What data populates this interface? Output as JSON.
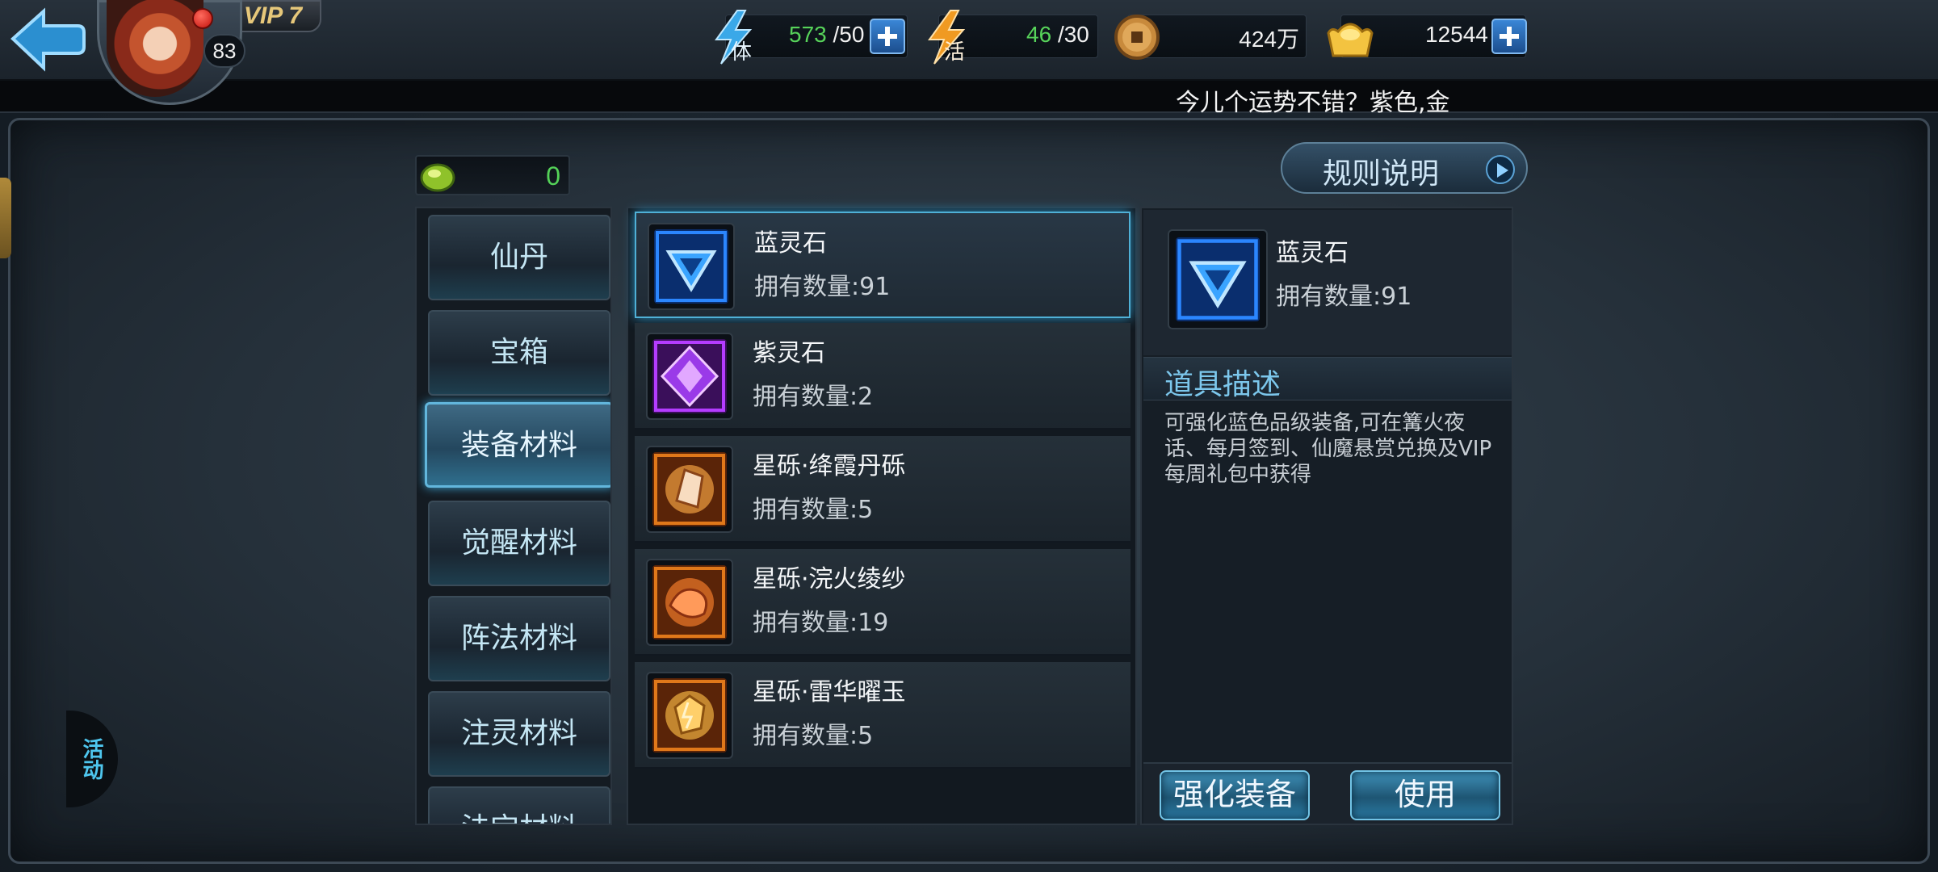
{
  "header": {
    "vip_label": "VIP 7",
    "player_level": "83",
    "stamina": {
      "icon": "stamina-lightning-icon",
      "current": "573",
      "max": "/50"
    },
    "activity": {
      "icon": "activity-lightning-icon",
      "current": "46",
      "max": "/30"
    },
    "copper": {
      "icon": "copper-coin-icon",
      "value": "424万"
    },
    "gold": {
      "icon": "gold-ingot-icon",
      "value": "12544"
    }
  },
  "marquee": {
    "text": "今儿个运势不错？紫色,金"
  },
  "currency": {
    "icon": "green-gem-icon",
    "value": "0"
  },
  "rules_button": {
    "label": "规则说明"
  },
  "categories": [
    {
      "label": "仙丹",
      "active": false
    },
    {
      "label": "宝箱",
      "active": false
    },
    {
      "label": "装备材料",
      "active": true
    },
    {
      "label": "觉醒材料",
      "active": false
    },
    {
      "label": "阵法材料",
      "active": false
    },
    {
      "label": "注灵材料",
      "active": false
    },
    {
      "label": "法宝材料",
      "active": false
    }
  ],
  "items": [
    {
      "name": "蓝灵石",
      "count": "拥有数量:91",
      "icon": "blue-spirit-stone-icon",
      "color": "#1e6ed6",
      "active": true
    },
    {
      "name": "紫灵石",
      "count": "拥有数量:2",
      "icon": "purple-spirit-stone-icon",
      "color": "#a23ad8",
      "active": false
    },
    {
      "name": "星砾·绛霞丹砾",
      "count": "拥有数量:5",
      "icon": "orange-star-gravel-icon",
      "color": "#e07a18",
      "active": false
    },
    {
      "name": "星砾·浣火绫纱",
      "count": "拥有数量:19",
      "icon": "orange-fire-silk-icon",
      "color": "#e8641a",
      "active": false
    },
    {
      "name": "星砾·雷华曜玉",
      "count": "拥有数量:5",
      "icon": "orange-thunder-jade-icon",
      "color": "#e88a1a",
      "active": false
    }
  ],
  "detail": {
    "name": "蓝灵石",
    "count": "拥有数量:91",
    "icon": "blue-spirit-stone-icon",
    "desc_title": "道具描述",
    "description": "可强化蓝色品级装备,可在篝火夜话、每月签到、仙魔悬赏兑换及VIP每周礼包中获得",
    "buttons": {
      "enhance": "强化装备",
      "use": "使用"
    }
  },
  "side_emblem": "活动"
}
